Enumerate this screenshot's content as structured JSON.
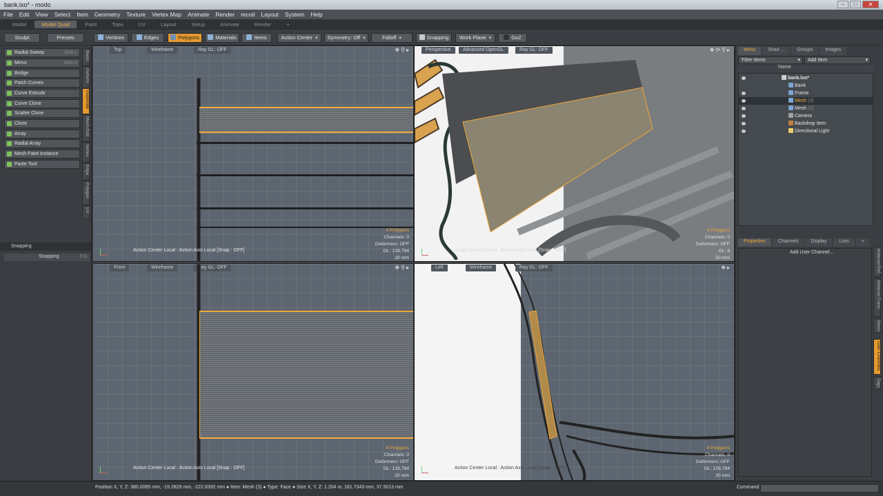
{
  "window": {
    "title": "bank.lxo* - modo"
  },
  "menu": [
    "File",
    "Edit",
    "View",
    "Select",
    "Item",
    "Geometry",
    "Texture",
    "Vertex Map",
    "Animate",
    "Render",
    "recoil",
    "Layout",
    "System",
    "Help"
  ],
  "layouts": [
    "Model",
    "Model Quad",
    "Paint",
    "Topo",
    "UV",
    "Layout",
    "Setup",
    "Animate",
    "Render",
    "+"
  ],
  "toolbar": {
    "sculpt": "Sculpt",
    "presets": "Presets",
    "vertices": "Vertices",
    "edges": "Edges",
    "polygons": "Polygons",
    "materials": "Materials",
    "items": "Items",
    "action_center": "Action Center",
    "symmetry": "Symmetry: Off",
    "falloff": "Falloff",
    "snapping": "Snapping",
    "work_plane": "Work Plane",
    "goz": "GoZ"
  },
  "tools": [
    {
      "label": "Radial Sweep",
      "shortcut": "Shift-L"
    },
    {
      "label": "Mirror",
      "shortcut": "Shift-V"
    },
    {
      "label": "Bridge",
      "shortcut": ""
    },
    {
      "label": "Patch Curves",
      "shortcut": ""
    },
    {
      "label": "Curve Extrude",
      "shortcut": ""
    },
    {
      "label": "Curve Clone",
      "shortcut": ""
    },
    {
      "label": "Scatter Clone",
      "shortcut": ""
    },
    {
      "label": "Clone",
      "shortcut": ""
    },
    {
      "label": "Array",
      "shortcut": ""
    },
    {
      "label": "Radial Array",
      "shortcut": ""
    },
    {
      "label": "Mesh Paint Instance",
      "shortcut": ""
    },
    {
      "label": "Paste Tool",
      "shortcut": ""
    }
  ],
  "side_tabs": [
    "Basic",
    "Deform",
    "Duplicate",
    "Mesh Edit",
    "Vertex",
    "Edge",
    "Polygon",
    "UV"
  ],
  "snapping": {
    "section": "Snapping",
    "button": "Snapping",
    "shortcut": "F11"
  },
  "viewports": [
    {
      "view": "Top",
      "shading": "Wireframe",
      "gl": "Ray GL: OFF",
      "polygons": "4 Polygons",
      "channels": "Channels: 0",
      "deformers": "Deformers: OFF",
      "gl_count": "GL: 129,784",
      "scale": "20 mm",
      "action": "Action Center Local : Action Axis Local  [Snap : OFF]"
    },
    {
      "view": "Perspective",
      "shading": "Advanced OpenGL",
      "gl": "Ray GL: OFF",
      "polygons": "4 Polygons",
      "channels": "Channels: 0",
      "deformers": "Deformers: OFF",
      "gl_count": "GL: 8",
      "scale": "50 mm",
      "action": "Action Center Local : Action Axis Local  [Snap : OFF]"
    },
    {
      "view": "Front",
      "shading": "Wireframe",
      "gl": "Ray GL: OFF",
      "polygons": "4 Polygons",
      "channels": "Channels: 0",
      "deformers": "Deformers: OFF",
      "gl_count": "GL: 129,784",
      "scale": "20 mm",
      "action": "Action Center Local : Action Axis Local  [Snap : OFF]"
    },
    {
      "view": "Left",
      "shading": "Wireframe",
      "gl": "Ray GL: OFF",
      "polygons": "4 Polygons",
      "channels": "Channels: 0",
      "deformers": "Deformers: OFF",
      "gl_count": "GL: 129,784",
      "scale": "20 mm",
      "action": "Action Center Local : Action Axis Local  [Snap : OFF]"
    }
  ],
  "items_panel": {
    "tabs": [
      "Items",
      "Shad ...",
      "Groups",
      "Images"
    ],
    "filter": "Filter Items",
    "add_item": "Add Item",
    "name_header": "Name",
    "rows": [
      {
        "label": "bank.lxo*",
        "count": ""
      },
      {
        "label": "Bank",
        "count": ""
      },
      {
        "label": "Frame",
        "count": ""
      },
      {
        "label": "Mesh",
        "count": "(3)"
      },
      {
        "label": "Mesh",
        "count": "(2)"
      },
      {
        "label": "Camera",
        "count": ""
      },
      {
        "label": "Backdrop Item",
        "count": ""
      },
      {
        "label": "Directional Light",
        "count": ""
      }
    ]
  },
  "properties_panel": {
    "tabs": [
      "Properties",
      "Channels",
      "Display",
      "Lists",
      "+"
    ],
    "add_channel": "Add User Channel...",
    "side_tabs": [
      "Material Ref",
      "Material Trans",
      "Mesh",
      "User Channels",
      "Tags"
    ]
  },
  "status": {
    "info": "Position X, Y, Z:  380.0065 mm, -19.2829 mm, -222.8392 mm ● Item:  Mesh (3) ● Type:  Face ● Size X, Y, Z:  1.204 m, 181.7343 mm, 37.5013 mm",
    "command": "Command"
  },
  "colors": {
    "accent": "#e69a2e",
    "poly_highlight": "#f0a83c",
    "viewport_bg": "#5d6670"
  }
}
